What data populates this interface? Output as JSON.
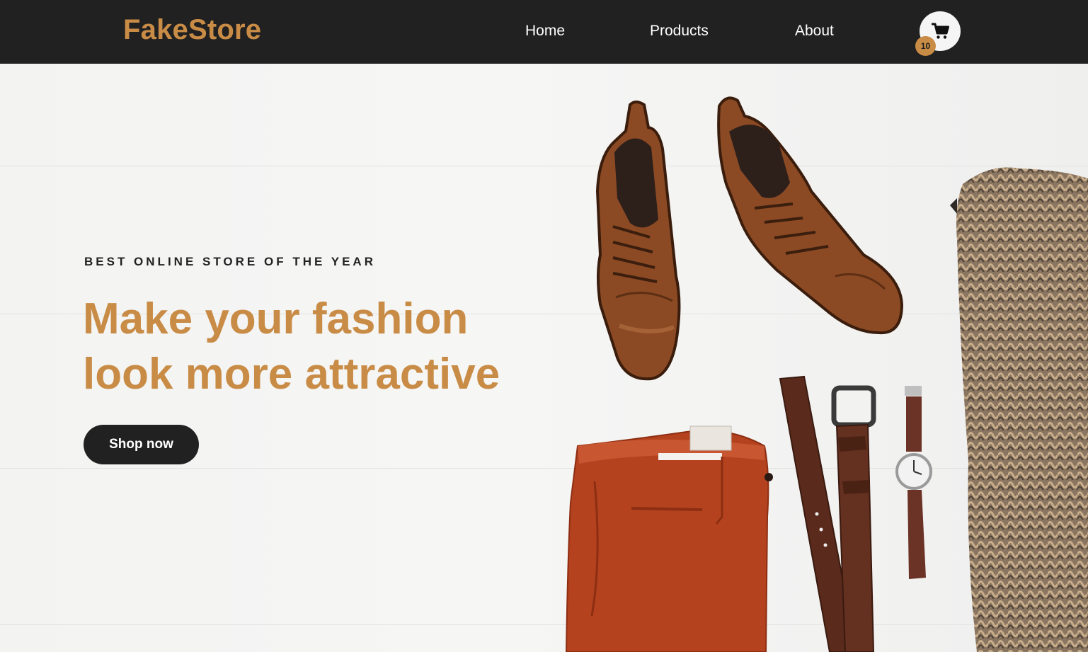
{
  "header": {
    "brand": "FakeStore",
    "nav": [
      {
        "label": "Home"
      },
      {
        "label": "Products"
      },
      {
        "label": "About"
      }
    ],
    "cart": {
      "icon": "cart-icon",
      "count": "10"
    }
  },
  "hero": {
    "tagline": "BEST ONLINE STORE OF THE YEAR",
    "headline_line1": "Make your fashion",
    "headline_line2": "look more attractive",
    "cta_label": "Shop now",
    "image_subject": "hero-fashion-flatlay"
  },
  "colors": {
    "accent": "#c98c46",
    "navbar": "#212121",
    "button": "#212121",
    "background": "#f2f2f1"
  }
}
